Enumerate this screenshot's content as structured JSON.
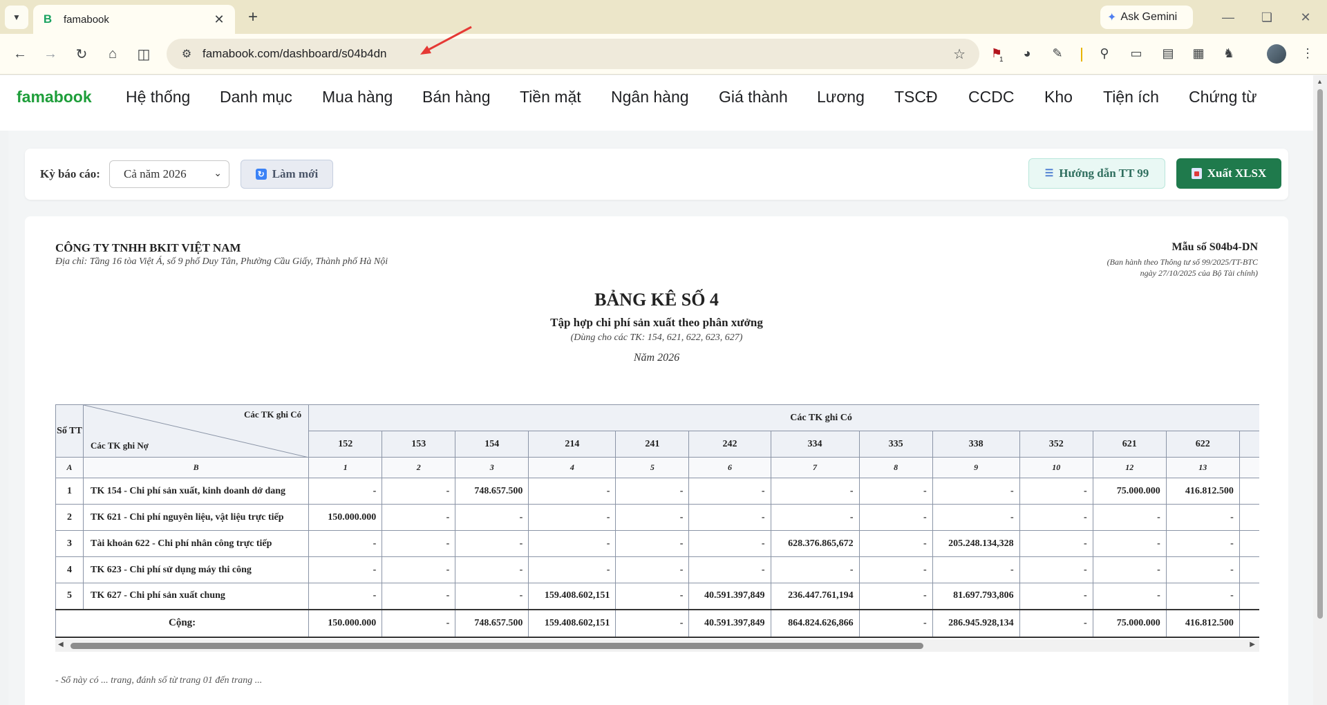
{
  "browser": {
    "tab_title": "famabook",
    "tab_favicon_letter": "B",
    "url": "famabook.com/dashboard/s04b4dn",
    "gemini_label": "Ask Gemini",
    "extension_badge": "1"
  },
  "app": {
    "brand": "famabook",
    "nav": [
      "Hệ thống",
      "Danh mục",
      "Mua hàng",
      "Bán hàng",
      "Tiền mặt",
      "Ngân hàng",
      "Giá thành",
      "Lương",
      "TSCĐ",
      "CCDC",
      "Kho",
      "Tiện ích",
      "Chứng từ"
    ]
  },
  "filter": {
    "label": "Kỳ báo cáo:",
    "period_value": "Cả năm 2026",
    "refresh_label": "Làm mới",
    "guide_label": "Hướng dẫn TT 99",
    "export_label": "Xuất XLSX"
  },
  "report": {
    "company": "CÔNG TY TNHH BKIT VIỆT NAM",
    "address": "Địa chỉ: Tầng 16 tòa Việt Á, số 9 phố Duy Tân, Phường Cầu Giấy, Thành phố Hà Nội",
    "form_code": "Mẫu số S04b4-DN",
    "form_note_1": "(Ban hành theo Thông tư số 99/2025/TT-BTC",
    "form_note_2": "ngày 27/10/2025 của Bộ Tài chính)",
    "title": "BẢNG KÊ SỐ 4",
    "subtitle": "Tập hợp chi phí sản xuất theo phân xưởng",
    "scope": "(Dùng cho các TK: 154, 621, 622, 623, 627)",
    "year": "Năm 2026",
    "footnote": "- Sổ này có ... trang, đánh số từ trang 01 đến trang ..."
  },
  "table": {
    "col_stt": "Số TT",
    "diag_top": "Các TK ghi Có",
    "diag_bottom": "Các TK ghi Nợ",
    "group_header": "Các TK ghi Có",
    "accounts": [
      "152",
      "153",
      "154",
      "214",
      "241",
      "242",
      "334",
      "335",
      "338",
      "352",
      "621",
      "622",
      ""
    ],
    "index_row": [
      "A",
      "B",
      "1",
      "2",
      "3",
      "4",
      "5",
      "6",
      "7",
      "8",
      "9",
      "10",
      "12",
      "13",
      ""
    ],
    "rows": [
      {
        "stt": "1",
        "account": "TK 154 - Chi phí sản xuất, kinh doanh dở dang",
        "values": [
          "-",
          "-",
          "748.657.500",
          "-",
          "-",
          "-",
          "-",
          "-",
          "-",
          "-",
          "75.000.000",
          "416.812.500",
          "-"
        ]
      },
      {
        "stt": "2",
        "account": "TK 621 - Chi phí nguyên liệu, vật liệu trực tiếp",
        "values": [
          "150.000.000",
          "-",
          "-",
          "-",
          "-",
          "-",
          "-",
          "-",
          "-",
          "-",
          "-",
          "-",
          "-"
        ]
      },
      {
        "stt": "3",
        "account": "Tài khoản 622 - Chi phí nhân công trực tiếp",
        "values": [
          "-",
          "-",
          "-",
          "-",
          "-",
          "-",
          "628.376.865,672",
          "-",
          "205.248.134,328",
          "-",
          "-",
          "-",
          "-"
        ]
      },
      {
        "stt": "4",
        "account": "TK 623 - Chi phí sử dụng máy thi công",
        "values": [
          "-",
          "-",
          "-",
          "-",
          "-",
          "-",
          "-",
          "-",
          "-",
          "-",
          "-",
          "-",
          "-"
        ]
      },
      {
        "stt": "5",
        "account": "TK 627 - Chi phí sản xuất chung",
        "values": [
          "-",
          "-",
          "-",
          "159.408.602,151",
          "-",
          "40.591.397,849",
          "236.447.761,194",
          "-",
          "81.697.793,806",
          "-",
          "-",
          "-",
          "-"
        ]
      }
    ],
    "total_label": "Cộng:",
    "totals": [
      "150.000.000",
      "-",
      "748.657.500",
      "159.408.602,151",
      "-",
      "40.591.397,849",
      "864.824.626,866",
      "-",
      "286.945.928,134",
      "-",
      "75.000.000",
      "416.812.500",
      "-"
    ]
  }
}
